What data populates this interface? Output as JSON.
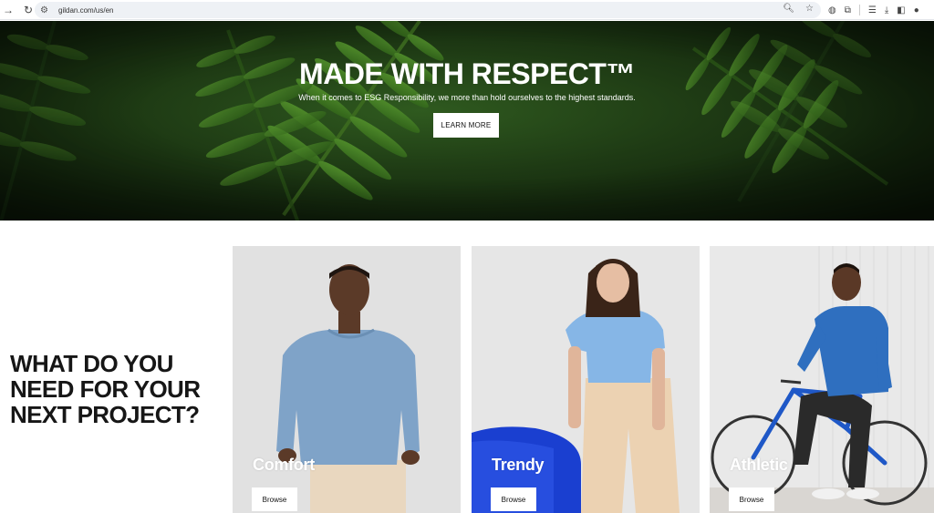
{
  "browser": {
    "url": "gildan.com/us/en"
  },
  "hero": {
    "title": "MADE WITH RESPECT™",
    "subtitle": "When it comes to ESG Responsibility, we more than hold ourselves to the highest standards.",
    "button_label": "LEARN MORE"
  },
  "section": {
    "title_lines": [
      "WHAT DO YOU",
      "NEED FOR YOUR",
      "NEXT PROJECT?"
    ]
  },
  "cards": [
    {
      "label": "Comfort",
      "button_label": "Browse"
    },
    {
      "label": "Trendy",
      "button_label": "Browse"
    },
    {
      "label": "Athletic",
      "button_label": "Browse"
    }
  ],
  "colors": {
    "hero_dark": "#13260d",
    "fern": "#4e8a2a",
    "text_dark": "#161616",
    "shirt_blue": "#7da6cc",
    "tee_blue": "#86b6e6",
    "athletic_blue": "#2f6fbf"
  }
}
